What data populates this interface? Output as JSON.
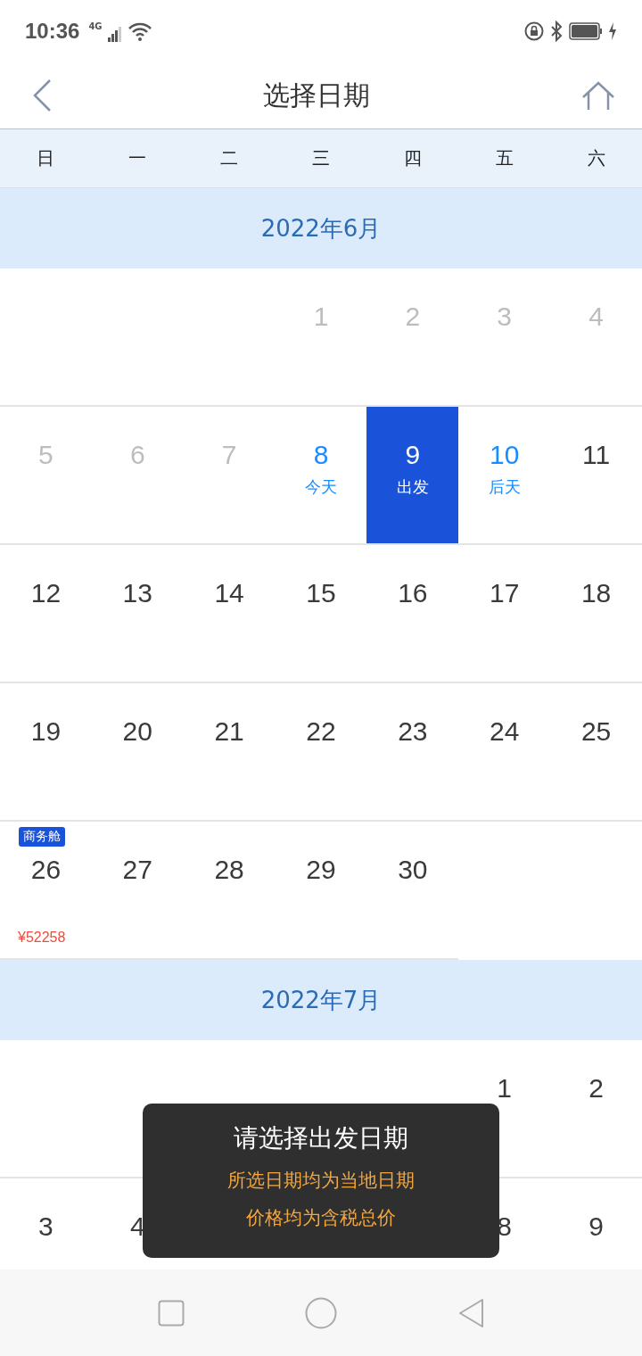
{
  "status_bar": {
    "time": "10:36",
    "network": "4G"
  },
  "header": {
    "title": "选择日期"
  },
  "weekdays": [
    "日",
    "一",
    "二",
    "三",
    "四",
    "五",
    "六"
  ],
  "months": [
    {
      "title": "2022年6月",
      "weeks": [
        [
          {
            "kind": "blank"
          },
          {
            "kind": "blank"
          },
          {
            "kind": "blank"
          },
          {
            "day": "1",
            "kind": "past"
          },
          {
            "day": "2",
            "kind": "past"
          },
          {
            "day": "3",
            "kind": "past"
          },
          {
            "day": "4",
            "kind": "past"
          }
        ],
        [
          {
            "day": "5",
            "kind": "past"
          },
          {
            "day": "6",
            "kind": "past"
          },
          {
            "day": "7",
            "kind": "past"
          },
          {
            "day": "8",
            "kind": "highlight",
            "note": "今天"
          },
          {
            "day": "9",
            "kind": "selected",
            "note": "出发"
          },
          {
            "day": "10",
            "kind": "highlight",
            "note": "后天"
          },
          {
            "day": "11",
            "kind": "normal"
          }
        ],
        [
          {
            "day": "12",
            "kind": "normal"
          },
          {
            "day": "13",
            "kind": "normal"
          },
          {
            "day": "14",
            "kind": "normal"
          },
          {
            "day": "15",
            "kind": "normal"
          },
          {
            "day": "16",
            "kind": "normal"
          },
          {
            "day": "17",
            "kind": "normal"
          },
          {
            "day": "18",
            "kind": "normal"
          }
        ],
        [
          {
            "day": "19",
            "kind": "normal"
          },
          {
            "day": "20",
            "kind": "normal"
          },
          {
            "day": "21",
            "kind": "normal"
          },
          {
            "day": "22",
            "kind": "normal"
          },
          {
            "day": "23",
            "kind": "normal"
          },
          {
            "day": "24",
            "kind": "normal"
          },
          {
            "day": "25",
            "kind": "normal"
          }
        ],
        [
          {
            "day": "26",
            "kind": "normal",
            "tag": "商务舱",
            "price": "¥52258"
          },
          {
            "day": "27",
            "kind": "normal"
          },
          {
            "day": "28",
            "kind": "normal"
          },
          {
            "day": "29",
            "kind": "normal"
          },
          {
            "day": "30",
            "kind": "normal"
          },
          {
            "kind": "blank"
          },
          {
            "kind": "blank"
          }
        ]
      ]
    },
    {
      "title": "2022年7月",
      "weeks": [
        [
          {
            "kind": "blank"
          },
          {
            "kind": "blank"
          },
          {
            "kind": "blank"
          },
          {
            "kind": "blank"
          },
          {
            "kind": "blank"
          },
          {
            "day": "1",
            "kind": "normal"
          },
          {
            "day": "2",
            "kind": "normal"
          }
        ],
        [
          {
            "day": "3",
            "kind": "normal"
          },
          {
            "day": "4",
            "kind": "normal"
          },
          {
            "kind": "blank"
          },
          {
            "kind": "blank"
          },
          {
            "kind": "blank"
          },
          {
            "day": "8",
            "kind": "normal"
          },
          {
            "day": "9",
            "kind": "normal"
          }
        ]
      ]
    }
  ],
  "toast": {
    "title": "请选择出发日期",
    "lines": [
      "所选日期均为当地日期",
      "价格均为含税总价"
    ]
  }
}
